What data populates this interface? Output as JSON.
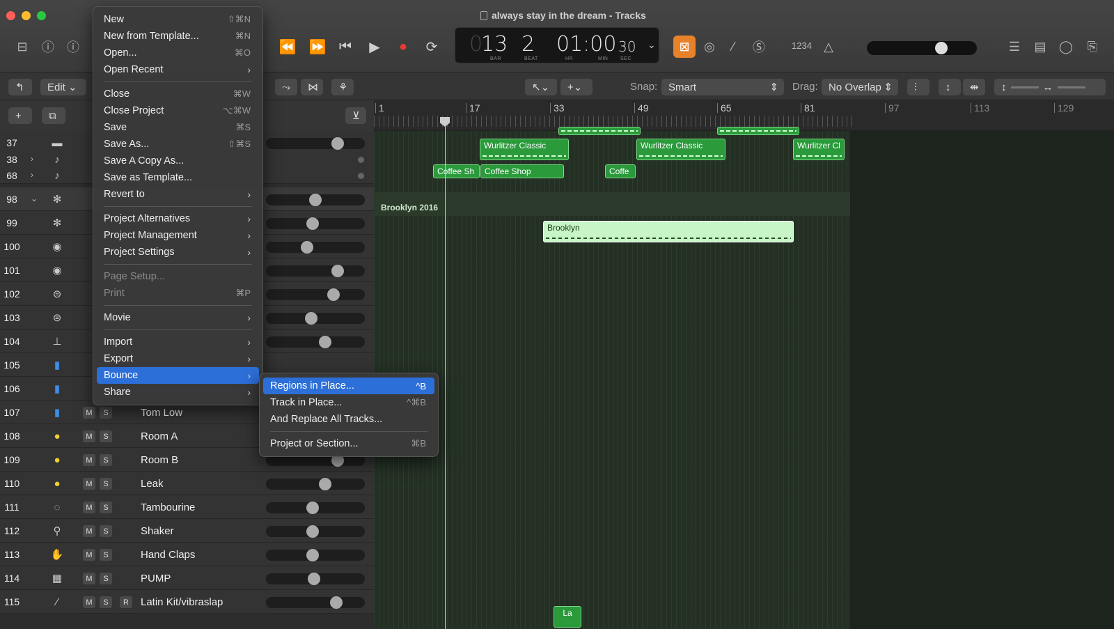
{
  "window": {
    "title": "always stay in the dream - Tracks"
  },
  "lcd": {
    "bar_prefix": "0",
    "bar": "13",
    "beat": "2",
    "bar_label": "BAR",
    "beat_label": "BEAT",
    "hr_min": "01:00",
    "sec": "30",
    "hr_label": "HR",
    "min_label": "MIN",
    "sec_label": "SEC"
  },
  "toolbar": {
    "edit": "Edit",
    "snap_label": "Snap:",
    "snap_value": "Smart",
    "drag_label": "Drag:",
    "drag_value": "No Overlap",
    "count": "1234"
  },
  "ruler": {
    "marks": [
      "1",
      "17",
      "33",
      "49",
      "65",
      "81",
      "97",
      "113",
      "129"
    ]
  },
  "file_menu": {
    "items": [
      {
        "label": "New",
        "shortcut": "⇧⌘N"
      },
      {
        "label": "New from Template...",
        "shortcut": "⌘N"
      },
      {
        "label": "Open...",
        "shortcut": "⌘O"
      },
      {
        "label": "Open Recent",
        "submenu": true
      },
      {
        "sep": true
      },
      {
        "label": "Close",
        "shortcut": "⌘W"
      },
      {
        "label": "Close Project",
        "shortcut": "⌥⌘W"
      },
      {
        "label": "Save",
        "shortcut": "⌘S"
      },
      {
        "label": "Save As...",
        "shortcut": "⇧⌘S"
      },
      {
        "label": "Save A Copy As..."
      },
      {
        "label": "Save as Template..."
      },
      {
        "label": "Revert to",
        "submenu": true
      },
      {
        "sep": true
      },
      {
        "label": "Project Alternatives",
        "submenu": true
      },
      {
        "label": "Project Management",
        "submenu": true
      },
      {
        "label": "Project Settings",
        "submenu": true
      },
      {
        "sep": true
      },
      {
        "label": "Page Setup...",
        "disabled": true
      },
      {
        "label": "Print",
        "shortcut": "⌘P",
        "disabled": true
      },
      {
        "sep": true
      },
      {
        "label": "Movie",
        "submenu": true
      },
      {
        "sep": true
      },
      {
        "label": "Import",
        "submenu": true
      },
      {
        "label": "Export",
        "submenu": true
      },
      {
        "label": "Bounce",
        "submenu": true,
        "highlighted": true
      },
      {
        "label": "Share",
        "submenu": true
      }
    ]
  },
  "bounce_menu": {
    "items": [
      {
        "label": "Regions in Place...",
        "shortcut": "^B",
        "highlighted": true
      },
      {
        "label": "Track in Place...",
        "shortcut": "^⌘B"
      },
      {
        "label": "And Replace All Tracks..."
      },
      {
        "sep": true
      },
      {
        "label": "Project or Section...",
        "shortcut": "⌘B"
      }
    ]
  },
  "tracks": [
    {
      "num": "37",
      "icon": "keyboard-icon",
      "name": ""
    },
    {
      "num": "38",
      "icon": "folder-icon",
      "name": ""
    },
    {
      "num": "68",
      "icon": "folder-icon",
      "name": ""
    },
    {
      "num": "98",
      "icon": "drumkit-icon",
      "name": ""
    },
    {
      "num": "99",
      "icon": "drumkit-icon",
      "name": ""
    },
    {
      "num": "100",
      "icon": "drum-icon",
      "name": ""
    },
    {
      "num": "101",
      "icon": "drum-icon",
      "name": ""
    },
    {
      "num": "102",
      "icon": "snare-icon",
      "name": ""
    },
    {
      "num": "103",
      "icon": "snare-icon",
      "name": ""
    },
    {
      "num": "104",
      "icon": "hihat-icon",
      "name": ""
    },
    {
      "num": "105",
      "icon": "tom-icon",
      "name": ""
    },
    {
      "num": "106",
      "icon": "tom-icon",
      "name": ""
    },
    {
      "num": "107",
      "icon": "tom-icon",
      "name": "Tom Low"
    },
    {
      "num": "108",
      "icon": "room-icon",
      "name": "Room A"
    },
    {
      "num": "109",
      "icon": "room-icon",
      "name": "Room B"
    },
    {
      "num": "110",
      "icon": "room-icon",
      "name": "Leak"
    },
    {
      "num": "111",
      "icon": "tambourine-icon",
      "name": "Tambourine"
    },
    {
      "num": "112",
      "icon": "shaker-icon",
      "name": "Shaker"
    },
    {
      "num": "113",
      "icon": "handclap-icon",
      "name": "Hand Claps"
    },
    {
      "num": "114",
      "icon": "synth-icon",
      "name": "PUMP"
    },
    {
      "num": "115",
      "icon": "stick-icon",
      "name": "Latin Kit/vibraslap"
    }
  ],
  "regions": {
    "wurlitzer1": "Wurlitzer Classic",
    "wurlitzer2": "Wurlitzer Classic",
    "wurlitzer3": "Wurlitzer Cl",
    "coffee1": "Coffee Sh",
    "coffee2": "Coffee Shop",
    "coffee3": "Coffe",
    "folder": "Brooklyn 2016",
    "brooklyn": "Brooklyn",
    "latin": "La"
  }
}
